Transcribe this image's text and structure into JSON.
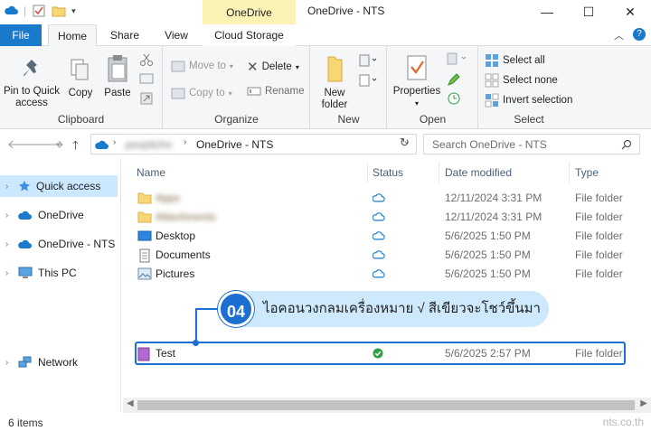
{
  "window": {
    "contextual_tab": "OneDrive",
    "title": "OneDrive - NTS",
    "minimize": "—",
    "maximize": "☐",
    "close": "✕"
  },
  "tabs": {
    "file": "File",
    "home": "Home",
    "share": "Share",
    "view": "View",
    "cloud_storage": "Cloud Storage"
  },
  "ribbon": {
    "clipboard": {
      "label": "Clipboard",
      "pin": "Pin to Quick access",
      "copy": "Copy",
      "paste": "Paste"
    },
    "organize": {
      "label": "Organize",
      "move_to": "Move to",
      "copy_to": "Copy to",
      "delete": "Delete",
      "rename": "Rename"
    },
    "new": {
      "label": "New",
      "new_folder": "New folder"
    },
    "open": {
      "label": "Open",
      "properties": "Properties"
    },
    "select": {
      "label": "Select",
      "select_all": "Select all",
      "select_none": "Select none",
      "invert_selection": "Invert selection"
    }
  },
  "address": {
    "path_user": "pexpitcho",
    "path_current": "OneDrive - NTS",
    "search_placeholder": "Search OneDrive - NTS"
  },
  "nav": {
    "quick_access": "Quick access",
    "onedrive": "OneDrive",
    "onedrive_nts": "OneDrive - NTS",
    "this_pc": "This PC",
    "network": "Network"
  },
  "columns": {
    "name": "Name",
    "status": "Status",
    "date": "Date modified",
    "type": "Type"
  },
  "files": [
    {
      "name": "Apps",
      "date": "12/11/2024 3:31 PM",
      "type": "File folder"
    },
    {
      "name": "Attachments",
      "date": "12/11/2024 3:31 PM",
      "type": "File folder"
    },
    {
      "name": "Desktop",
      "date": "5/6/2025 1:50 PM",
      "type": "File folder"
    },
    {
      "name": "Documents",
      "date": "5/6/2025 1:50 PM",
      "type": "File folder"
    },
    {
      "name": "Pictures",
      "date": "5/6/2025 1:50 PM",
      "type": "File folder"
    },
    {
      "name": "Test",
      "date": "5/6/2025 2:57 PM",
      "type": "File folder"
    }
  ],
  "callout": {
    "number": "04",
    "text": "ไอคอนวงกลมเครื่องหมาย √ สีเขียวจะโชว์ขึ้นมา"
  },
  "status_bar": {
    "items": "6 items",
    "watermark": "nts.co.th"
  },
  "colors": {
    "accent": "#1a6fd1",
    "file_tab": "#1979ca",
    "contextual": "#fbf3b5",
    "selected_nav": "#cce8ff",
    "synced_green": "#2ea043",
    "cloud_blue": "#1979ca"
  }
}
